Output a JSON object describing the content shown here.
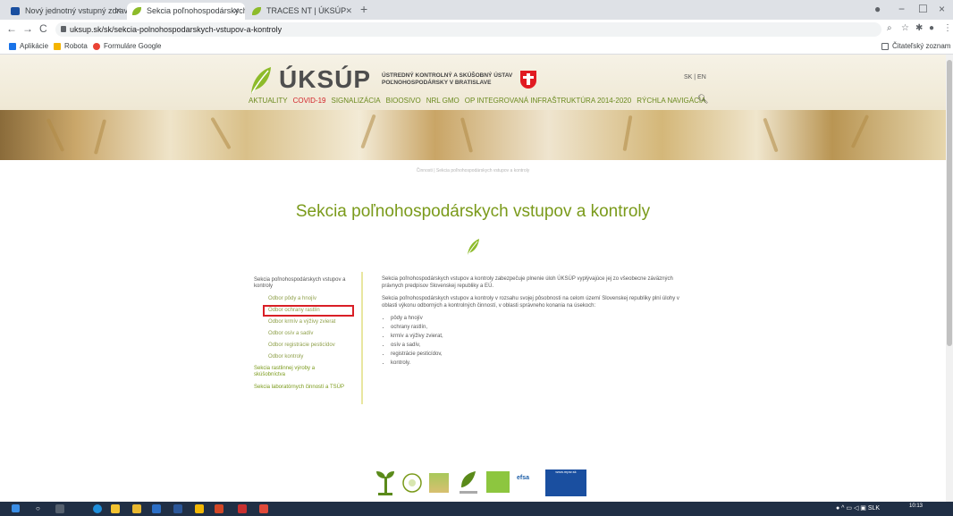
{
  "browser": {
    "tabs": [
      {
        "title": "Nový jednotný vstupný zdravotn",
        "active": false
      },
      {
        "title": "Sekcia poľnohospodárskych vstu",
        "active": true
      },
      {
        "title": "TRACES NT | ÚKSÚP",
        "active": false
      }
    ],
    "new_tab": "+",
    "url": "uksup.sk/sk/sekcia-polnohospodarskych-vstupov-a-kontroly",
    "bookmarks": [
      "Aplikácie",
      "Robota",
      "Formuláre Google"
    ],
    "reading_list": "Čitateľský zoznam",
    "window_controls": {
      "minimize": "−",
      "maximize": "☐",
      "close": "×"
    }
  },
  "site": {
    "logo": "ÚKSÚP",
    "institution_line1": "ÚSTREDNÝ KONTROLNÝ A SKÚŠOBNÝ ÚSTAV",
    "institution_line2": "POĽNOHOSPODÁRSKY V BRATISLAVE",
    "lang": "SK | EN",
    "menu": [
      {
        "label": "AKTUALITY",
        "hot": false
      },
      {
        "label": "COVID-19",
        "hot": true
      },
      {
        "label": "SIGNALIZÁCIA",
        "hot": false
      },
      {
        "label": "BIOOSIVO",
        "hot": false
      },
      {
        "label": "NRL GMO",
        "hot": false
      },
      {
        "label": "OP INTEGROVANÁ INFRAŠTRUKTÚRA 2014-2020",
        "hot": false
      },
      {
        "label": "RÝCHLA NAVIGÁCIA",
        "hot": false
      }
    ],
    "breadcrumb": "Činnosti | Sekcia poľnohospodárskych vstupov a kontroly",
    "page_title": "Sekcia poľnohospodárskych vstupov a kontroly",
    "sidebar": {
      "section": "Sekcia poľnohospodárskych vstupov a kontroly",
      "items": [
        "Odbor pôdy a hnojív",
        "Odbor ochrany rastlín",
        "Odbor krmív a výživy zvierat",
        "Odbor osív a sadív",
        "Odbor registrácie pesticídov",
        "Odbor kontroly"
      ],
      "sections": [
        "Sekcia rastlinnej výroby a skúšobníctva",
        "Sekcia laboratórnych činností a TSÚP"
      ]
    },
    "content": {
      "p1": "Sekcia poľnohospodárskych vstupov a kontroly zabezpečuje plnenie úloh ÚKSÚP vyplývajúce jej zo všeobecne záväzných právnych predpisov Slovenskej republiky a EÚ.",
      "p2": "Sekcia poľnohospodárskych vstupov a kontroly v rozsahu svojej pôsobnosti na celom území Slovenskej republiky plní úlohy v oblasti výkonu odborných a kontrolných činností, v oblasti správneho konania na úsekoch:",
      "list": [
        "pôdy a hnojív",
        "ochrany rastlín,",
        "krmív a výživy zvierat,",
        "osív a sadív,",
        "registrácie pesticídov,",
        "kontroly."
      ]
    },
    "footer_logos": [
      "efsa",
      "www.mpsr.sk"
    ]
  },
  "taskbar": {
    "time": "10:13",
    "lang": "SLK"
  },
  "colors": {
    "brand_green": "#7a9a1a",
    "accent_red": "#d2232a"
  }
}
